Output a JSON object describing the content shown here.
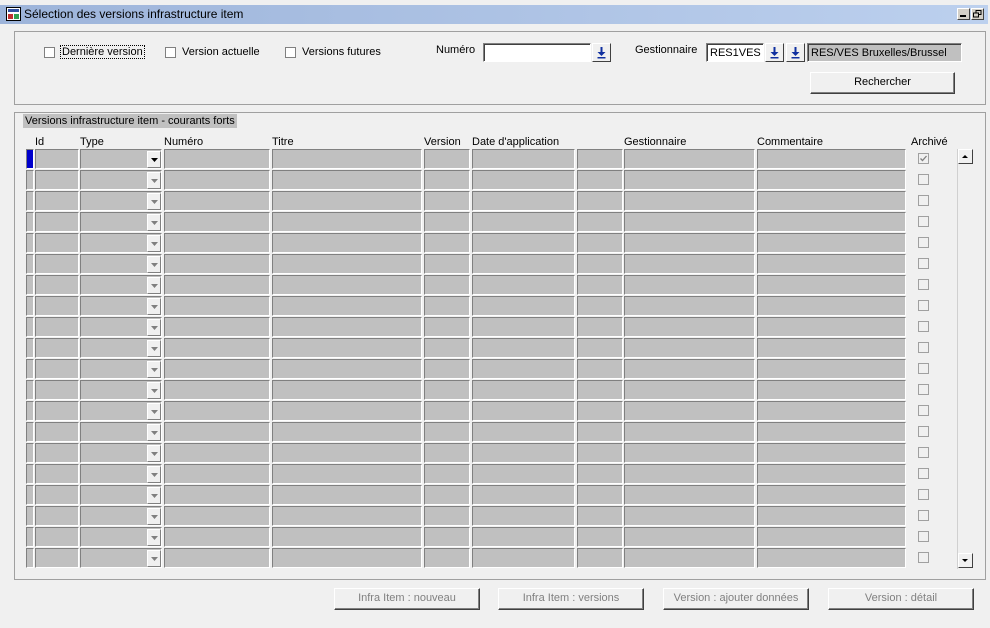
{
  "window": {
    "title": "Sélection des versions infrastructure item"
  },
  "search": {
    "checkboxes": [
      {
        "label": "Dernière version",
        "checked": false
      },
      {
        "label": "Version actuelle",
        "checked": false
      },
      {
        "label": "Versions futures",
        "checked": false
      }
    ],
    "numero_label": "Numéro",
    "numero_value": "",
    "gestionnaire_label": "Gestionnaire",
    "gestionnaire_code": "RES1VES",
    "gestionnaire_name": "RES/VES Bruxelles/Brussel",
    "search_button": "Rechercher"
  },
  "grid": {
    "title": "Versions infrastructure item - courants forts",
    "columns": [
      "Id",
      "Type",
      "Numéro",
      "Titre",
      "Version",
      "Date d'application",
      "Gestionnaire",
      "Commentaire",
      "Archivé"
    ],
    "row_count": 20,
    "rows_archived": [
      true,
      false,
      false,
      false,
      false,
      false,
      false,
      false,
      false,
      false,
      false,
      false,
      false,
      false,
      false,
      false,
      false,
      false,
      false,
      false
    ]
  },
  "buttons": {
    "new": "Infra Item : nouveau",
    "versions": "Infra Item : versions",
    "add_data": "Version : ajouter données",
    "detail": "Version : détail"
  },
  "colors": {
    "titlebar_start": "#9db4da",
    "titlebar_end": "#bcd0ee",
    "cell_gray": "#c0c0c0",
    "row_indicator": "#0000cc"
  }
}
